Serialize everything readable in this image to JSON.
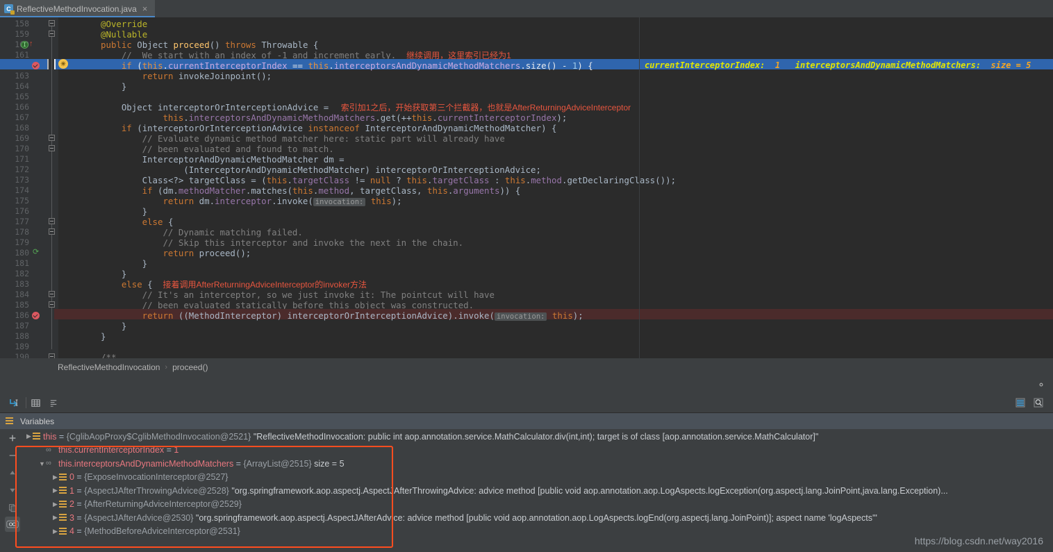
{
  "tab": {
    "label": "ReflectiveMethodInvocation.java",
    "close": "×",
    "icon": "java-class-icon"
  },
  "editor": {
    "first_line": 158,
    "lines": [
      {
        "n": 158,
        "indent": 9,
        "segments": [
          {
            "t": "@Override",
            "c": "ann"
          }
        ]
      },
      {
        "n": 159,
        "indent": 9,
        "segments": [
          {
            "t": "@Nullable",
            "c": "ann"
          }
        ]
      },
      {
        "n": 160,
        "indent": 9,
        "segments": [
          {
            "t": "public ",
            "c": "k"
          },
          {
            "t": "Object ",
            "c": "t"
          },
          {
            "t": "proceed",
            "c": "f"
          },
          {
            "t": "() ",
            "c": "t"
          },
          {
            "t": "throws ",
            "c": "k"
          },
          {
            "t": "Throwable {",
            "c": "t"
          }
        ]
      },
      {
        "n": 161,
        "indent": 13,
        "segments": [
          {
            "t": "//  We start with an index of -1 and increment early.  ",
            "c": "c"
          },
          {
            "t": "继续调用，这里索引已经为1",
            "c": "note"
          }
        ]
      },
      {
        "n": 162,
        "indent": 13,
        "highlight": true,
        "segments": [
          {
            "t": "if ",
            "c": "k"
          },
          {
            "t": "(",
            "c": "t"
          },
          {
            "t": "this",
            "c": "k"
          },
          {
            "t": ".",
            "c": "t"
          },
          {
            "t": "currentInterceptorIndex",
            "c": "fld"
          },
          {
            "t": " == ",
            "c": "t"
          },
          {
            "t": "this",
            "c": "k"
          },
          {
            "t": ".",
            "c": "t"
          },
          {
            "t": "interceptorsAndDynamicMethodMatchers",
            "c": "fld"
          },
          {
            "t": ".size() - ",
            "c": "t"
          },
          {
            "t": "1",
            "c": "n"
          },
          {
            "t": ") {",
            "c": "t"
          }
        ],
        "inline_values": [
          {
            "label": "currentInterceptorIndex:",
            "value": "1"
          },
          {
            "label": "interceptorsAndDynamicMethodMatchers:",
            "value": "size = 5"
          }
        ]
      },
      {
        "n": 163,
        "indent": 17,
        "segments": [
          {
            "t": "return ",
            "c": "k"
          },
          {
            "t": "invokeJoinpoint();",
            "c": "t"
          }
        ]
      },
      {
        "n": 164,
        "indent": 13,
        "segments": [
          {
            "t": "}",
            "c": "t"
          }
        ]
      },
      {
        "n": 165,
        "indent": 0,
        "segments": []
      },
      {
        "n": 166,
        "indent": 13,
        "segments": [
          {
            "t": "Object interceptorOrInterceptionAdvice = ",
            "c": "t"
          },
          {
            "t": "   索引加1之后，开始获取第三个拦截器，也就是AfterReturningAdviceInterceptor",
            "c": "note"
          }
        ]
      },
      {
        "n": 167,
        "indent": 21,
        "segments": [
          {
            "t": "this",
            "c": "k"
          },
          {
            "t": ".",
            "c": "t"
          },
          {
            "t": "interceptorsAndDynamicMethodMatchers",
            "c": "fld"
          },
          {
            "t": ".get(++",
            "c": "t"
          },
          {
            "t": "this",
            "c": "k"
          },
          {
            "t": ".",
            "c": "t"
          },
          {
            "t": "currentInterceptorIndex",
            "c": "fld"
          },
          {
            "t": ");",
            "c": "t"
          }
        ]
      },
      {
        "n": 168,
        "indent": 13,
        "segments": [
          {
            "t": "if ",
            "c": "k"
          },
          {
            "t": "(interceptorOrInterceptionAdvice ",
            "c": "t"
          },
          {
            "t": "instanceof ",
            "c": "k"
          },
          {
            "t": "InterceptorAndDynamicMethodMatcher) {",
            "c": "t"
          }
        ]
      },
      {
        "n": 169,
        "indent": 17,
        "segments": [
          {
            "t": "// Evaluate dynamic method matcher here: static part will already have",
            "c": "c"
          }
        ]
      },
      {
        "n": 170,
        "indent": 17,
        "segments": [
          {
            "t": "// been evaluated and found to match.",
            "c": "c"
          }
        ]
      },
      {
        "n": 171,
        "indent": 17,
        "segments": [
          {
            "t": "InterceptorAndDynamicMethodMatcher dm =",
            "c": "t"
          }
        ]
      },
      {
        "n": 172,
        "indent": 25,
        "segments": [
          {
            "t": "(InterceptorAndDynamicMethodMatcher) interceptorOrInterceptionAdvice;",
            "c": "t"
          }
        ]
      },
      {
        "n": 173,
        "indent": 17,
        "segments": [
          {
            "t": "Class<?> targetClass = (",
            "c": "t"
          },
          {
            "t": "this",
            "c": "k"
          },
          {
            "t": ".",
            "c": "t"
          },
          {
            "t": "targetClass",
            "c": "fld"
          },
          {
            "t": " != ",
            "c": "t"
          },
          {
            "t": "null ",
            "c": "k"
          },
          {
            "t": "? ",
            "c": "t"
          },
          {
            "t": "this",
            "c": "k"
          },
          {
            "t": ".",
            "c": "t"
          },
          {
            "t": "targetClass",
            "c": "fld"
          },
          {
            "t": " : ",
            "c": "t"
          },
          {
            "t": "this",
            "c": "k"
          },
          {
            "t": ".",
            "c": "t"
          },
          {
            "t": "method",
            "c": "fld"
          },
          {
            "t": ".getDeclaringClass());",
            "c": "t"
          }
        ]
      },
      {
        "n": 174,
        "indent": 17,
        "segments": [
          {
            "t": "if ",
            "c": "k"
          },
          {
            "t": "(dm.",
            "c": "t"
          },
          {
            "t": "methodMatcher",
            "c": "fld"
          },
          {
            "t": ".matches(",
            "c": "t"
          },
          {
            "t": "this",
            "c": "k"
          },
          {
            "t": ".",
            "c": "t"
          },
          {
            "t": "method",
            "c": "fld"
          },
          {
            "t": ", targetClass, ",
            "c": "t"
          },
          {
            "t": "this",
            "c": "k"
          },
          {
            "t": ".",
            "c": "t"
          },
          {
            "t": "arguments",
            "c": "fld"
          },
          {
            "t": ")) {",
            "c": "t"
          }
        ]
      },
      {
        "n": 175,
        "indent": 21,
        "segments": [
          {
            "t": "return ",
            "c": "k"
          },
          {
            "t": "dm.",
            "c": "t"
          },
          {
            "t": "interceptor",
            "c": "fld"
          },
          {
            "t": ".invoke(",
            "c": "t"
          }
        ],
        "hint": {
          "text": "invocation:",
          "after": [
            {
              "t": " ",
              "c": "t"
            },
            {
              "t": "this",
              "c": "k"
            },
            {
              "t": ");",
              "c": "t"
            }
          ]
        }
      },
      {
        "n": 176,
        "indent": 17,
        "segments": [
          {
            "t": "}",
            "c": "t"
          }
        ]
      },
      {
        "n": 177,
        "indent": 17,
        "segments": [
          {
            "t": "else ",
            "c": "k"
          },
          {
            "t": "{",
            "c": "t"
          }
        ]
      },
      {
        "n": 178,
        "indent": 21,
        "segments": [
          {
            "t": "// Dynamic matching failed.",
            "c": "c"
          }
        ]
      },
      {
        "n": 179,
        "indent": 21,
        "segments": [
          {
            "t": "// Skip this interceptor and invoke the next in the chain.",
            "c": "c"
          }
        ]
      },
      {
        "n": 180,
        "indent": 21,
        "segments": [
          {
            "t": "return ",
            "c": "k"
          },
          {
            "t": "proceed();",
            "c": "t"
          }
        ]
      },
      {
        "n": 181,
        "indent": 17,
        "segments": [
          {
            "t": "}",
            "c": "t"
          }
        ]
      },
      {
        "n": 182,
        "indent": 13,
        "segments": [
          {
            "t": "}",
            "c": "t"
          }
        ]
      },
      {
        "n": 183,
        "indent": 13,
        "segments": [
          {
            "t": "else ",
            "c": "k"
          },
          {
            "t": "{  ",
            "c": "t"
          },
          {
            "t": "接着调用AfterReturningAdviceInterceptor的invoker方法",
            "c": "note"
          }
        ]
      },
      {
        "n": 184,
        "indent": 17,
        "segments": [
          {
            "t": "// It's an interceptor, so we just invoke it: The pointcut will have",
            "c": "c"
          }
        ]
      },
      {
        "n": 185,
        "indent": 17,
        "segments": [
          {
            "t": "// been evaluated statically before this object was constructed.",
            "c": "c"
          }
        ]
      },
      {
        "n": 186,
        "indent": 17,
        "breakpoint_line": true,
        "segments": [
          {
            "t": "return ",
            "c": "k"
          },
          {
            "t": "((MethodInterceptor) interceptorOrInterceptionAdvice).invoke(",
            "c": "t"
          }
        ],
        "hint": {
          "text": "invocation:",
          "after": [
            {
              "t": " ",
              "c": "t"
            },
            {
              "t": "this",
              "c": "k"
            },
            {
              "t": ");",
              "c": "t"
            }
          ]
        }
      },
      {
        "n": 187,
        "indent": 13,
        "segments": [
          {
            "t": "}",
            "c": "t"
          }
        ]
      },
      {
        "n": 188,
        "indent": 9,
        "segments": [
          {
            "t": "}",
            "c": "t"
          }
        ]
      },
      {
        "n": 189,
        "indent": 0,
        "segments": []
      },
      {
        "n": 190,
        "indent": 9,
        "segments": [
          {
            "t": "/**",
            "c": "c"
          }
        ]
      }
    ],
    "gutter": {
      "breakpoint_lines": [
        162,
        186
      ],
      "run_marker_line": 160,
      "green_check_line": 180,
      "bulb_line": 162
    }
  },
  "breadcrumb": {
    "items": [
      "ReflectiveMethodInvocation",
      "proceed()"
    ],
    "separator": "›"
  },
  "debug": {
    "settings_icon": "gear-icon",
    "toolbar_buttons": [
      {
        "name": "evaluate-expression-icon",
        "glyph": "↲"
      },
      {
        "name": "table-view-icon",
        "glyph": "▦"
      },
      {
        "name": "sort-values-icon",
        "glyph": "≡"
      }
    ],
    "right_buttons": [
      {
        "name": "layout-settings-icon",
        "glyph": "☰"
      },
      {
        "name": "inspect-icon",
        "glyph": "⌕"
      }
    ],
    "side_tools": [
      {
        "name": "add-watch-button",
        "glyph": "+"
      },
      {
        "name": "remove-watch-button",
        "glyph": "−"
      },
      {
        "name": "move-up-button",
        "glyph": "▲"
      },
      {
        "name": "move-down-button",
        "glyph": "▼"
      },
      {
        "name": "copy-button",
        "glyph": "❐"
      },
      {
        "name": "watches-toggle-button",
        "glyph": "∞"
      }
    ],
    "variables_label": "Variables",
    "variables": [
      {
        "indent": 0,
        "arrow": "▶",
        "icon": "object-icon",
        "name": "this",
        "eq": " = ",
        "ref": "{CglibAopProxy$CglibMethodInvocation@2521}",
        "str": "\"ReflectiveMethodInvocation: public int aop.annotation.service.MathCalculator.div(int,int); target is of class [aop.annotation.service.MathCalculator]\"",
        "extra": ""
      },
      {
        "indent": 1,
        "arrow": "",
        "icon": "watch-icon",
        "name": "this.currentInterceptorIndex",
        "eq": " = ",
        "ref": "",
        "num": "1",
        "str": "",
        "extra": ""
      },
      {
        "indent": 1,
        "arrow": "▼",
        "icon": "watch-icon",
        "name": "this.interceptorsAndDynamicMethodMatchers",
        "eq": " = ",
        "ref": "{ArrayList@2515}",
        "str": "",
        "extra": "size = 5"
      },
      {
        "indent": 2,
        "arrow": "▶",
        "icon": "object-icon",
        "name": "0",
        "eq": " = ",
        "ref": "{ExposeInvocationInterceptor@2527}",
        "str": "",
        "extra": ""
      },
      {
        "indent": 2,
        "arrow": "▶",
        "icon": "object-icon",
        "name": "1",
        "eq": " = ",
        "ref": "{AspectJAfterThrowingAdvice@2528}",
        "str": "\"org.springframework.aop.aspectj.AspectJAfterThrowingAdvice: advice method [public void aop.annotation.aop.LogAspects.logException(org.aspectj.lang.JoinPoint,java.lang.Exception)...",
        "extra": ""
      },
      {
        "indent": 2,
        "arrow": "▶",
        "icon": "object-icon",
        "name": "2",
        "eq": " = ",
        "ref": "{AfterReturningAdviceInterceptor@2529}",
        "str": "",
        "extra": ""
      },
      {
        "indent": 2,
        "arrow": "▶",
        "icon": "object-icon",
        "name": "3",
        "eq": " = ",
        "ref": "{AspectJAfterAdvice@2530}",
        "str": "\"org.springframework.aop.aspectj.AspectJAfterAdvice: advice method [public void aop.annotation.aop.LogAspects.logEnd(org.aspectj.lang.JoinPoint)]; aspect name 'logAspects'\"",
        "extra": ""
      },
      {
        "indent": 2,
        "arrow": "▶",
        "icon": "object-icon",
        "name": "4",
        "eq": " = ",
        "ref": "{MethodBeforeAdviceInterceptor@2531}",
        "str": "",
        "extra": ""
      }
    ]
  },
  "watermark": "https://blog.csdn.net/way2016",
  "colors": {
    "accent": "#2f65ad",
    "annotation_red": "#ff4d1f",
    "inline_value": "#e3e600",
    "breakpoint": "#db5860"
  }
}
